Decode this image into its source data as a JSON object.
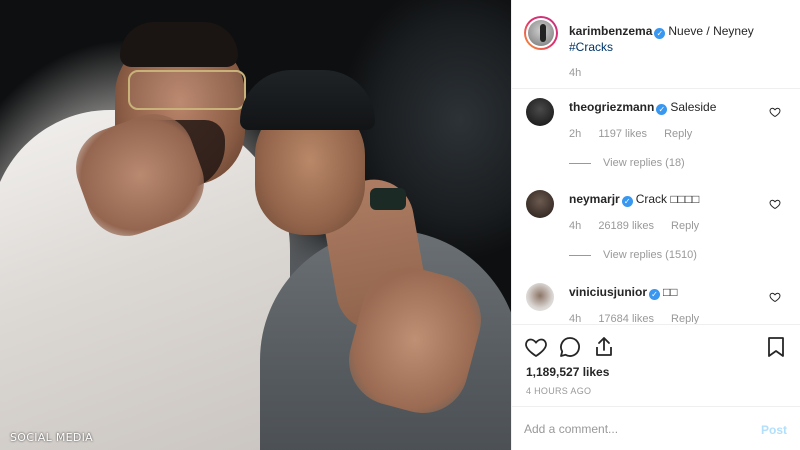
{
  "photo": {
    "watermark": "SOCIAL MEDIA"
  },
  "caption": {
    "username": "karimbenzema",
    "verified_mark": "✓",
    "text": "Nueve / Neyney",
    "hashtag": "#Cracks",
    "time": "4h"
  },
  "comments": [
    {
      "username": "theogriezmann",
      "text": "Saleside",
      "time": "2h",
      "likes": "1197 likes",
      "reply_label": "Reply",
      "view_replies": "View replies (18)"
    },
    {
      "username": "neymarjr",
      "text": "Crack □□□□",
      "time": "4h",
      "likes": "26189 likes",
      "reply_label": "Reply",
      "view_replies": "View replies (1510)"
    },
    {
      "username": "viniciusjunior",
      "text": "□□",
      "time": "4h",
      "likes": "17684 likes",
      "reply_label": "Reply"
    }
  ],
  "actions": {
    "like_icon": "heart-outline-icon",
    "comment_icon": "comment-bubble-icon",
    "share_icon": "share-icon",
    "save_icon": "bookmark-icon"
  },
  "stats": {
    "likes": "1,189,527 likes",
    "posted": "4 HOURS AGO"
  },
  "add_comment": {
    "placeholder": "Add a comment...",
    "post_label": "Post"
  },
  "colors": {
    "verified": "#3897f0",
    "hashtag": "#003569",
    "muted": "#999999",
    "post_disabled": "#b2dffc"
  }
}
